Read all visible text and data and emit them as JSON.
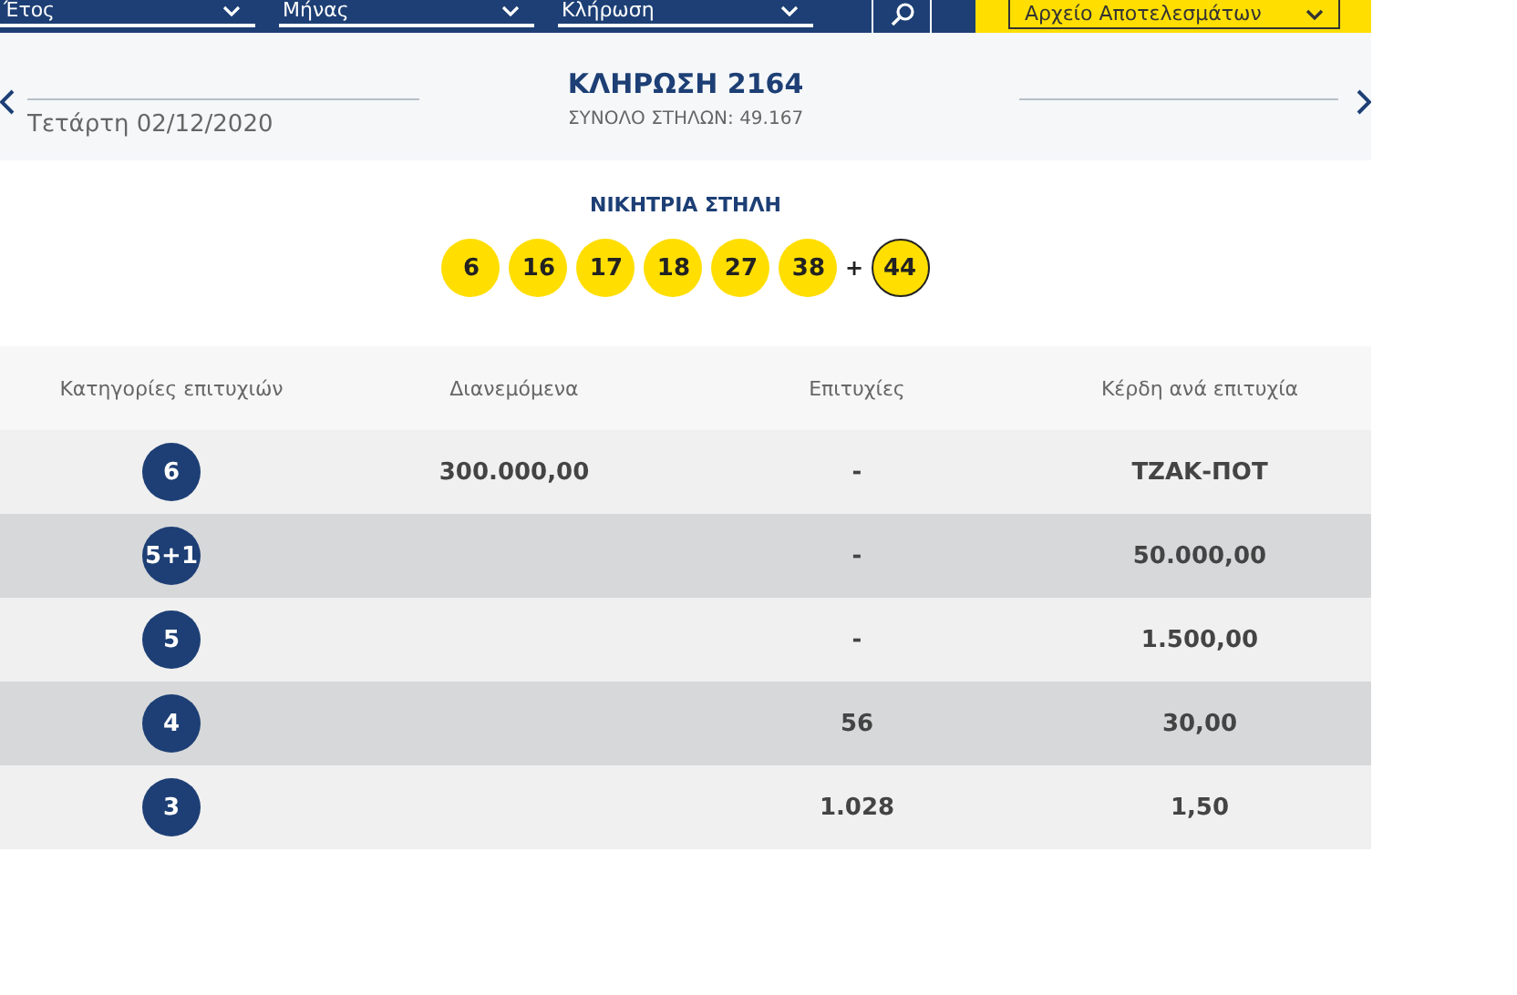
{
  "filters": [
    {
      "label": "Έτος"
    },
    {
      "label": "Μήνας"
    },
    {
      "label": "Κλήρωση"
    }
  ],
  "archive_button": "Αρχείο Αποτελεσμάτων",
  "draw": {
    "title": "ΚΛΗΡΩΣΗ 2164",
    "date": "Τετάρτη 02/12/2020",
    "total_columns": "ΣΥΝΟΛΟ ΣΤΗΛΩΝ: 49.167"
  },
  "winning": {
    "title": "ΝΙΚΗΤΡΙΑ ΣΤΗΛΗ",
    "numbers": [
      "6",
      "16",
      "17",
      "18",
      "27",
      "38"
    ],
    "plus": "+",
    "bonus": "44"
  },
  "table": {
    "columns": [
      "Κατηγορίες επιτυχιών",
      "Διανεμόμενα",
      "Επιτυχίες",
      "Κέρδη ανά επιτυχία"
    ],
    "rows": [
      {
        "category": "6",
        "distributed": "300.000,00",
        "winners": "-",
        "prize": "ΤΖΑΚ-ΠΟΤ"
      },
      {
        "category": "5+1",
        "winners": "-",
        "prize": "50.000,00"
      },
      {
        "category": "5",
        "winners": "-",
        "prize": "1.500,00"
      },
      {
        "category": "4",
        "winners": "56",
        "prize": "30,00"
      },
      {
        "category": "3",
        "winners": "1.028",
        "prize": "1,50"
      }
    ]
  }
}
